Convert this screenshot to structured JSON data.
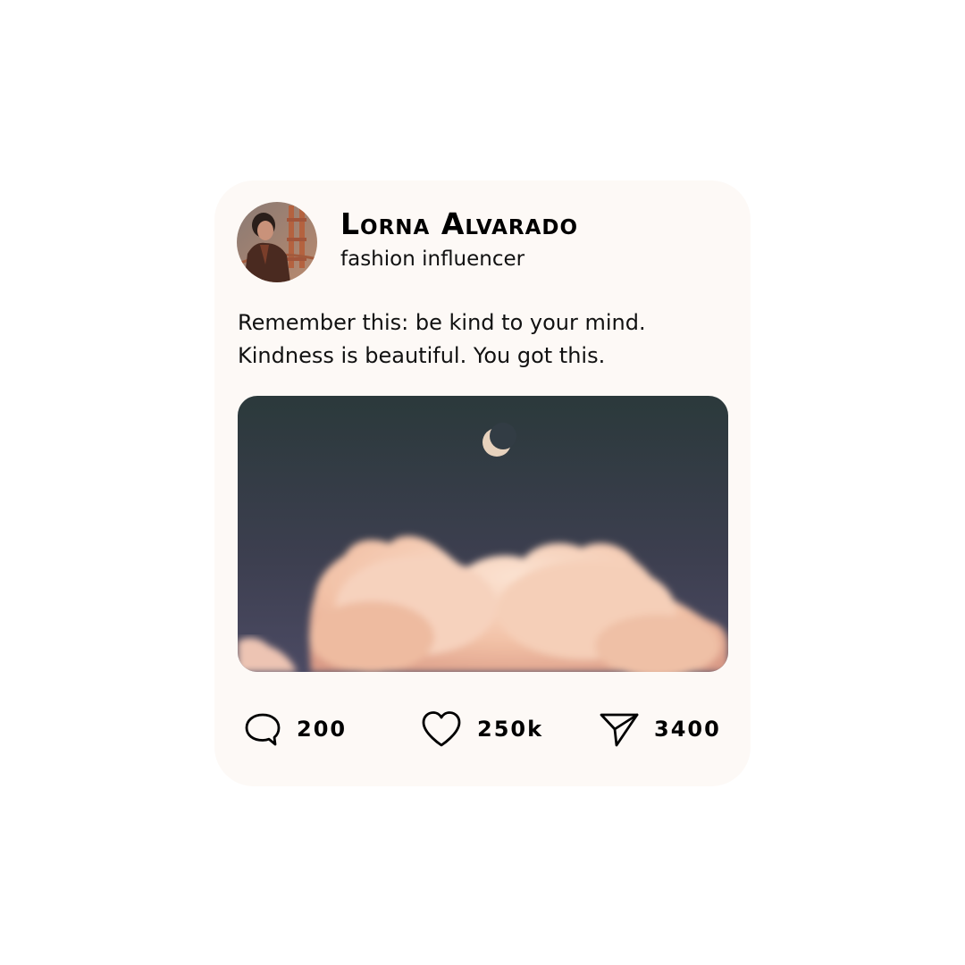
{
  "post": {
    "author_name": "Lorna Alvarado",
    "author_role": "fashion influencer",
    "caption_lines": [
      "Remember this: be kind to your mind.",
      "Kindness is beautiful. You got this."
    ],
    "image_alt": "crescent moon above pink clouds at dusk",
    "actions": {
      "comments": {
        "icon": "comment-icon",
        "count": "200"
      },
      "likes": {
        "icon": "heart-icon",
        "count": "250k"
      },
      "shares": {
        "icon": "send-icon",
        "count": "3400"
      }
    }
  },
  "colors": {
    "card_background": "#fdf9f6",
    "text": "#000000",
    "sky_top": "#2c3a3d",
    "sky_bottom": "#45455a",
    "cloud": "#f3c6ac"
  }
}
